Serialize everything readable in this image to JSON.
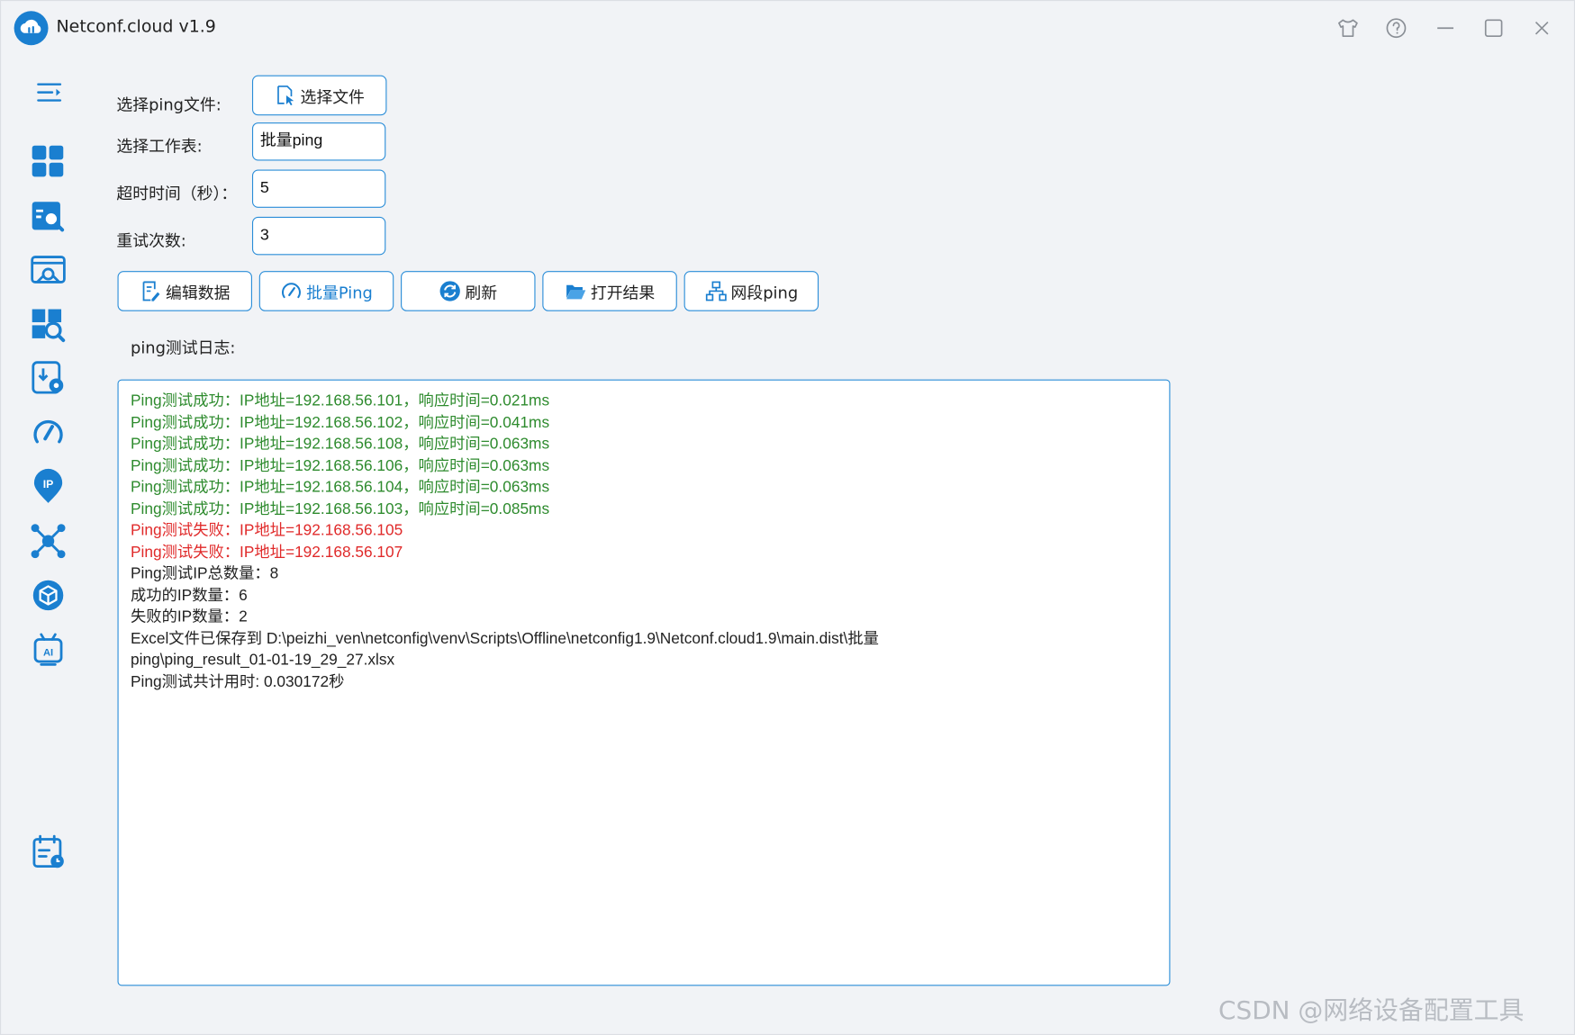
{
  "app": {
    "title": "Netconf.cloud v1.9"
  },
  "titlebar": {
    "buttons": [
      {
        "name": "skin-icon"
      },
      {
        "name": "help-icon"
      },
      {
        "name": "minimize-icon"
      },
      {
        "name": "maximize-icon"
      },
      {
        "name": "close-icon"
      }
    ]
  },
  "sidebar": {
    "items": [
      {
        "name": "collapse-menu-icon"
      },
      {
        "name": "dashboard-icon"
      },
      {
        "name": "device-search-icon"
      },
      {
        "name": "config-backup-icon"
      },
      {
        "name": "inspection-icon"
      },
      {
        "name": "config-deploy-icon"
      },
      {
        "name": "ping-speed-icon"
      },
      {
        "name": "ip-location-icon"
      },
      {
        "name": "topology-icon"
      },
      {
        "name": "package-icon"
      },
      {
        "name": "ai-robot-icon"
      },
      {
        "name": "schedule-icon"
      }
    ]
  },
  "form": {
    "file_label": "选择ping文件:",
    "file_button": "选择文件",
    "sheet_label": "选择工作表:",
    "sheet_value": "批量ping",
    "timeout_label": "超时时间（秒）：",
    "timeout_value": "5",
    "retry_label": "重试次数:",
    "retry_value": "3"
  },
  "actions": {
    "edit": "编辑数据",
    "batch_ping": "批量Ping",
    "refresh": "刷新",
    "open_result": "打开结果",
    "segment_ping": "网段ping"
  },
  "log": {
    "label": "ping测试日志:",
    "lines": [
      {
        "text": "Ping测试成功：IP地址=192.168.56.101，响应时间=0.021ms",
        "status": "success"
      },
      {
        "text": "Ping测试成功：IP地址=192.168.56.102，响应时间=0.041ms",
        "status": "success"
      },
      {
        "text": "Ping测试成功：IP地址=192.168.56.108，响应时间=0.063ms",
        "status": "success"
      },
      {
        "text": "Ping测试成功：IP地址=192.168.56.106，响应时间=0.063ms",
        "status": "success"
      },
      {
        "text": "Ping测试成功：IP地址=192.168.56.104，响应时间=0.063ms",
        "status": "success"
      },
      {
        "text": "Ping测试成功：IP地址=192.168.56.103，响应时间=0.085ms",
        "status": "success"
      },
      {
        "text": "Ping测试失败：IP地址=192.168.56.105",
        "status": "fail"
      },
      {
        "text": "Ping测试失败：IP地址=192.168.56.107",
        "status": "fail"
      },
      {
        "text": "Ping测试IP总数量：8",
        "status": "info"
      },
      {
        "text": "成功的IP数量：6",
        "status": "info"
      },
      {
        "text": "失败的IP数量：2",
        "status": "info"
      },
      {
        "text": "Excel文件已保存到 D:\\peizhi_ven\\netconfig\\venv\\Scripts\\Offline\\netconfig1.9\\Netconf.cloud1.9\\main.dist\\批量",
        "status": "info"
      },
      {
        "text": "ping\\ping_result_01-01-19_29_27.xlsx",
        "status": "info"
      },
      {
        "text": "Ping测试共计用时: 0.030172秒",
        "status": "info"
      }
    ]
  },
  "watermark": "CSDN @网络设备配置工具",
  "colors": {
    "accent": "#1a7fd0",
    "border": "#2a8dd8",
    "success": "#2e8b2e",
    "fail": "#e02a2a",
    "info": "#222222"
  }
}
